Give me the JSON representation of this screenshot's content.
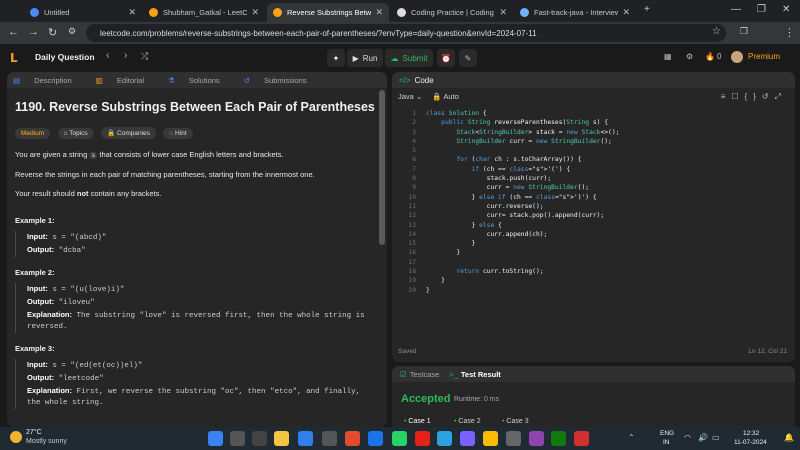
{
  "browser": {
    "tabs": [
      {
        "title": "Untitled",
        "color": "#4c8bf5",
        "active": false
      },
      {
        "title": "Shubham_Gatkal - LeetCode Pr",
        "color": "#ffa116",
        "active": false
      },
      {
        "title": "Reverse Substrings Between Ea",
        "color": "#ffa116",
        "active": true
      },
      {
        "title": "Coding Practice | Coding Challe",
        "color": "#ddd",
        "active": false
      },
      {
        "title": "Fast-track-java - Interviewbit",
        "color": "#6fb0ff",
        "active": false
      }
    ],
    "url": "leetcode.com/problems/reverse-substrings-between-each-pair-of-parentheses/?envType=daily-question&envId=2024-07-11"
  },
  "lcnav": {
    "daily": "Daily Question",
    "run": "Run",
    "submit": "Submit",
    "coins": "0",
    "premium": "Premium"
  },
  "left_tabs": [
    "Description",
    "Editorial",
    "Solutions",
    "Submissions"
  ],
  "problem": {
    "title": "1190. Reverse Substrings Between Each Pair of Parentheses",
    "difficulty": "Medium",
    "chips": [
      "Topics",
      "Companies",
      "Hint"
    ],
    "p1_pre": "You are given a string",
    "p1_code": "s",
    "p1_post": "that consists of lower case English letters and brackets.",
    "p2": "Reverse the strings in each pair of matching parentheses, starting from the innermost one.",
    "p3_pre": "Your result should",
    "p3_bold": "not",
    "p3_post": "contain any brackets.",
    "examples": [
      {
        "head": "Example 1:",
        "input": "s = \"(abcd)\"",
        "output": "\"dcba\"",
        "explanation": ""
      },
      {
        "head": "Example 2:",
        "input": "s = \"(u(love)i)\"",
        "output": "\"iloveu\"",
        "explanation": "The substring \"love\" is reversed first, then the whole string is reversed."
      },
      {
        "head": "Example 3:",
        "input": "s = \"(ed(et(oc))el)\"",
        "output": "\"leetcode\"",
        "explanation": "First, we reverse the substring \"oc\", then \"etco\", and finally, the whole string."
      }
    ],
    "labels": {
      "input": "Input:",
      "output": "Output:",
      "explanation": "Explanation:"
    }
  },
  "code_panel": {
    "title": "Code",
    "language": "Java",
    "mode": "Auto",
    "status": "Saved",
    "cursor": "Ln 12, Col 21",
    "lines": [
      "class Solution {",
      "    public String reverseParentheses(String s) {",
      "        Stack<StringBuilder> stack = new Stack<>();",
      "        StringBuilder curr = new StringBuilder();",
      "",
      "        for (char ch : s.toCharArray()) {",
      "            if (ch == '(') {",
      "                stack.push(curr);",
      "                curr = new StringBuilder();",
      "            } else if (ch == ')') {",
      "                curr.reverse();",
      "                curr= stack.pop().append(curr);",
      "            } else {",
      "                curr.append(ch);",
      "            }",
      "        }",
      "",
      "        return curr.toString();",
      "    }",
      "}"
    ]
  },
  "test_panel": {
    "tab_testcase": "Testcase",
    "tab_result": "Test Result",
    "verdict": "Accepted",
    "runtime": "Runtime: 0 ms",
    "cases": [
      "Case 1",
      "Case 2",
      "Case 3"
    ]
  },
  "taskbar": {
    "temp": "27°C",
    "weather": "Mostly sunny",
    "lang1": "ENG",
    "lang2": "IN",
    "time": "12:32",
    "date": "11-07-2024"
  }
}
